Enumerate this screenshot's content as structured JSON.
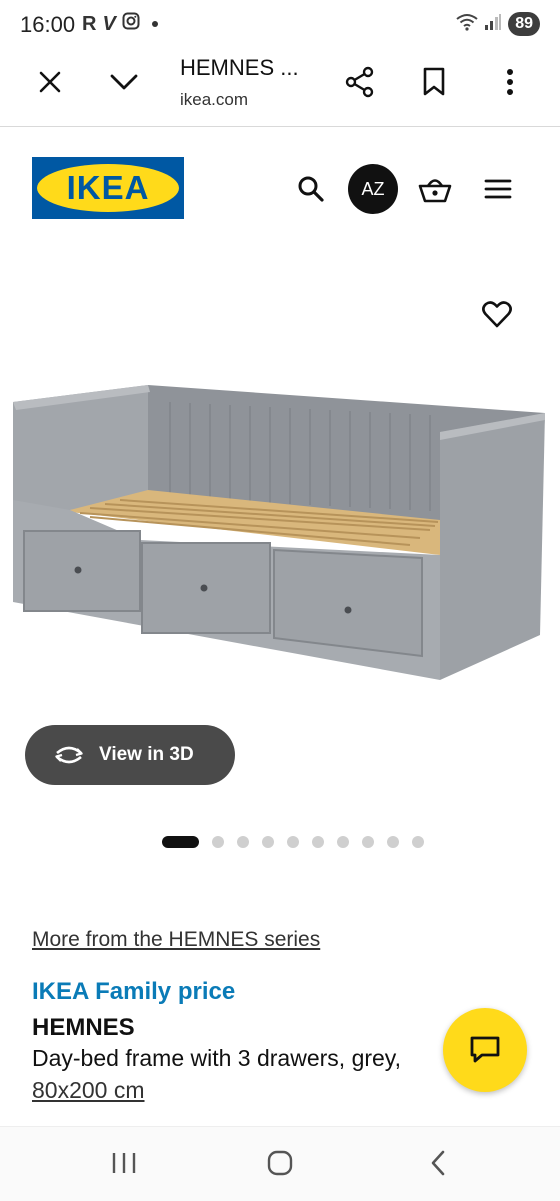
{
  "status_bar": {
    "time": "16:00",
    "notification_icons": [
      "R",
      "V",
      "instagram-icon"
    ],
    "battery": "89"
  },
  "browser": {
    "tab_title": "HEMNES ...",
    "domain": "ikea.com"
  },
  "site_header": {
    "logo_text": "IKEA",
    "avatar_initials": "AZ"
  },
  "gallery": {
    "view_3d_label": "View in 3D",
    "total_images": 10,
    "active_index": 0
  },
  "product": {
    "series_link": "More from the HEMNES series",
    "price_label": "IKEA Family price",
    "name": "HEMNES",
    "description": "Day-bed frame with 3 drawers, grey,",
    "size": "80x200 cm"
  },
  "colors": {
    "ikea_blue": "#0058a3",
    "ikea_yellow": "#ffda1a",
    "family_blue": "#0a7bb7"
  }
}
